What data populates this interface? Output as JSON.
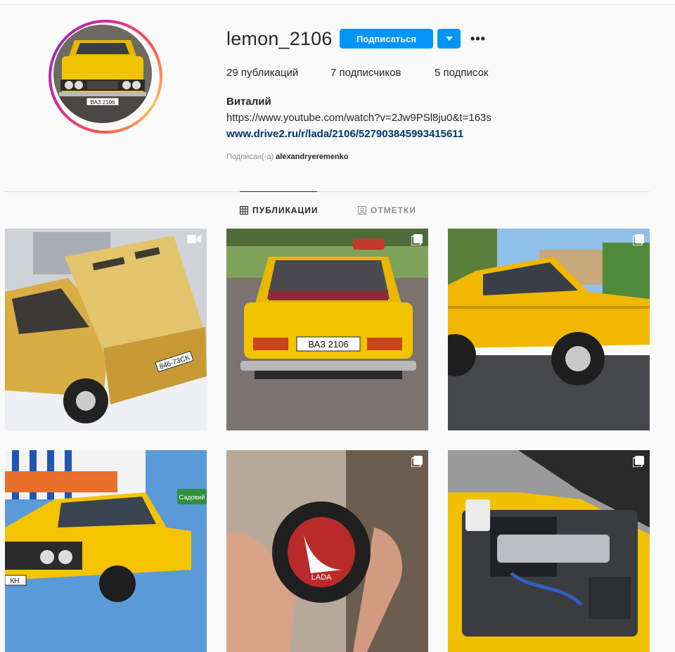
{
  "profile": {
    "username": "lemon_2106",
    "follow_label": "Подписаться",
    "more_label": "•••"
  },
  "stats": {
    "posts": "29 публикаций",
    "followers": "7 подписчиков",
    "following": "5 подписок"
  },
  "bio": {
    "name": "Виталий",
    "line1": "https://www.youtube.com/watch?v=2Jw9PSl8ju0&t=163s",
    "link": "www.drive2.ru/r/lada/2106/527903845993415611",
    "followed_prefix": "Подписан(-а)",
    "followed_user": "alexandryeremenko"
  },
  "tabs": {
    "posts_label": "ПУБЛИКАЦИИ",
    "tagged_label": "ОТМЕТКИ"
  },
  "posts": [
    {
      "plate": "846-73CK",
      "type": "video",
      "icon": "video-camera-icon"
    },
    {
      "plate": "ВАЗ 2106",
      "type": "carousel",
      "icon": "carousel-icon"
    },
    {
      "plate": "",
      "type": "carousel",
      "icon": "carousel-icon"
    },
    {
      "plate": "КН",
      "sign": "Садовий",
      "type": "single"
    },
    {
      "logo_text": "LADA",
      "type": "carousel",
      "icon": "carousel-icon"
    },
    {
      "plate": "",
      "type": "carousel",
      "icon": "carousel-icon"
    }
  ],
  "avatar": {
    "plate": "ВАЗ 2106"
  },
  "colors": {
    "accent_blue": "#0095f6",
    "link_blue": "#00376b",
    "car_yellow": "#f2c400",
    "background": "#fafafa"
  }
}
